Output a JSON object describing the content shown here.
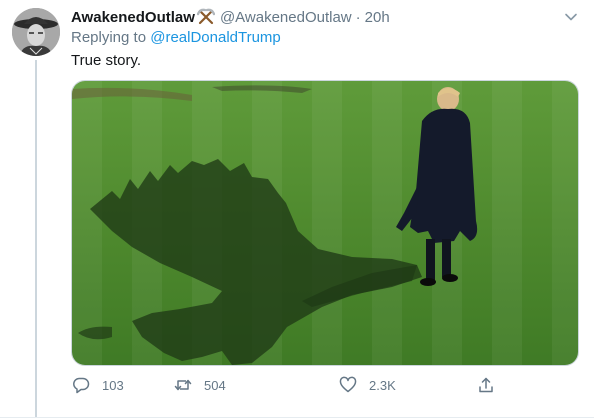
{
  "tweet": {
    "display_name": "AwakenedOutlaw",
    "emoji_icon": "crossed-pickaxes-icon",
    "handle": "@AwakenedOutlaw",
    "separator": "·",
    "time": "20h",
    "reply_prefix": "Replying to ",
    "reply_mention": "@realDonaldTrump",
    "text": "True story.",
    "media_icon": "photo-of-man-walking-on-lawn-with-dragon-shadow"
  },
  "actions": {
    "reply_count": "103",
    "retweet_count": "504",
    "like_count": "2.3K"
  },
  "colors": {
    "link": "#1b95e0",
    "secondary_text": "#657786",
    "primary_text": "#14171a",
    "lawn_green": "#4f8a2e"
  }
}
